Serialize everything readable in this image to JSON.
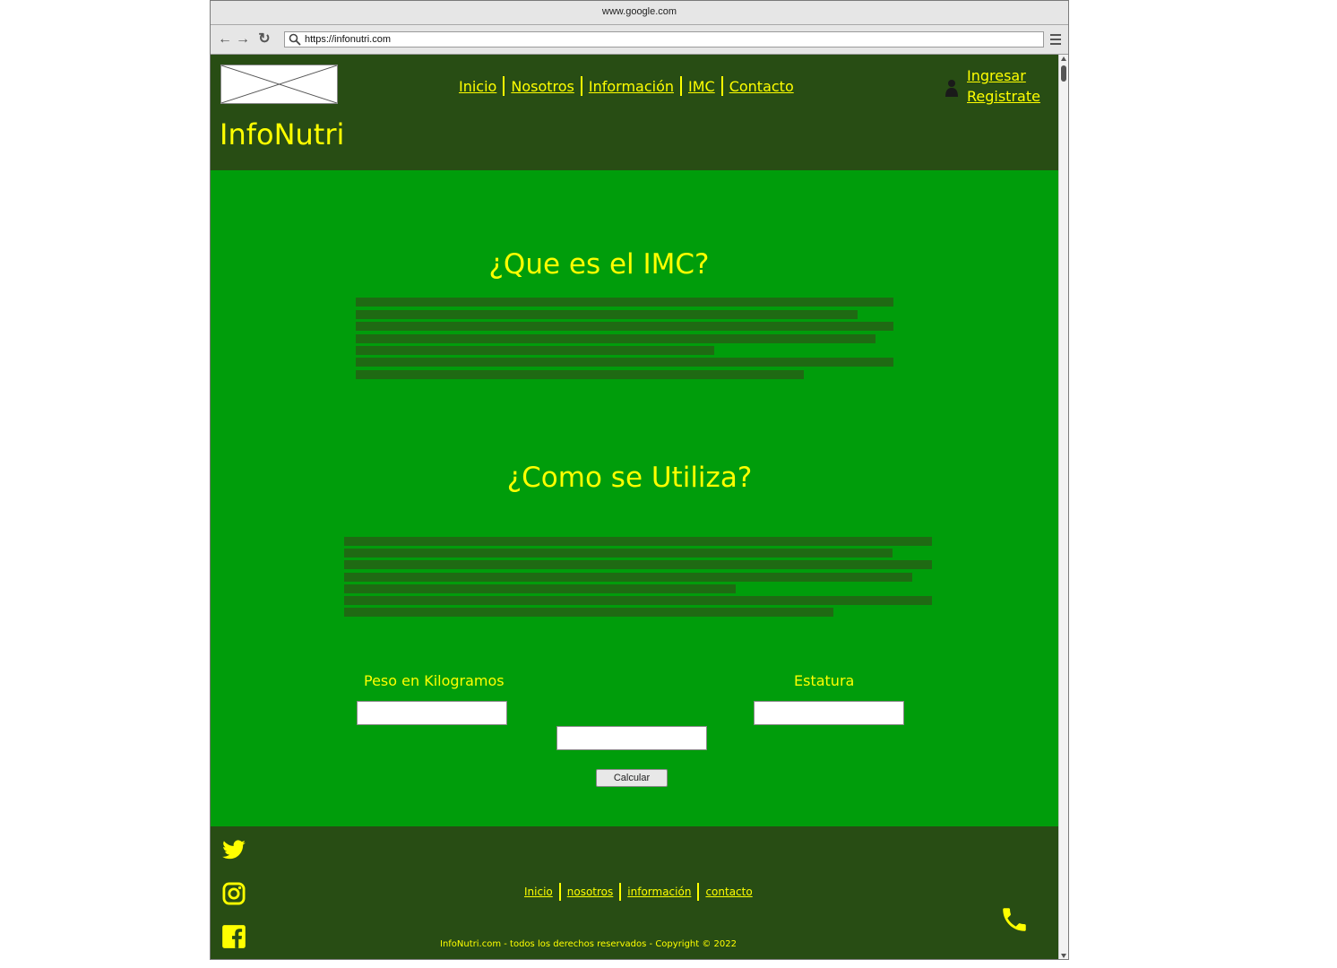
{
  "browser": {
    "title": "www.google.com",
    "url": "https://infonutri.com"
  },
  "header": {
    "brand": "InfoNutri",
    "nav": [
      "Inicio",
      "Nosotros",
      "Información",
      "IMC",
      "Contacto"
    ],
    "auth": [
      "Ingresar",
      "Registrate"
    ]
  },
  "sections": {
    "imc_title": "¿Que es el IMC?",
    "usage_title": "¿Como se Utiliza?"
  },
  "form": {
    "weight_label": "Peso en Kilogramos",
    "height_label": "Estatura",
    "calculate_label": "Calcular"
  },
  "footer": {
    "nav": [
      "Inicio",
      "nosotros",
      "información",
      "contacto"
    ],
    "copyright": "InfoNutri.com - todos los derechos reservados - Copyright © 2022"
  },
  "colors": {
    "header_bg": "#284d14",
    "body_bg": "#009d0b",
    "accent": "#ffff00"
  },
  "icons": [
    "twitter-icon",
    "instagram-icon",
    "facebook-icon",
    "phone-icon",
    "user-icon"
  ]
}
